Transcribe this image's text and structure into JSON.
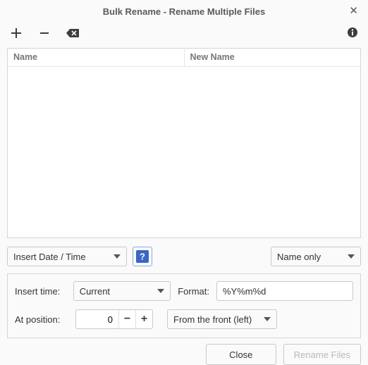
{
  "window": {
    "title": "Bulk Rename - Rename Multiple Files"
  },
  "table": {
    "col_name": "Name",
    "col_newname": "New Name"
  },
  "controls": {
    "operation": "Insert Date / Time",
    "scope": "Name only"
  },
  "panel": {
    "insert_time_label": "Insert time:",
    "insert_time_value": "Current",
    "format_label": "Format:",
    "format_value": "%Y%m%d",
    "position_label": "At position:",
    "position_value": "0",
    "from_value": "From the front (left)"
  },
  "footer": {
    "close": "Close",
    "rename": "Rename Files"
  }
}
